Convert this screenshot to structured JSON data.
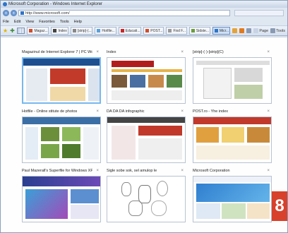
{
  "window": {
    "title": "Microsoft Corporation - Windows Internet Explorer"
  },
  "address_bar": {
    "url": "http://www.microsoft.com/"
  },
  "menu": {
    "items": [
      "File",
      "Edit",
      "View",
      "Favorites",
      "Tools",
      "Help"
    ]
  },
  "tabs": [
    {
      "label": "Magaz..."
    },
    {
      "label": "Index"
    },
    {
      "label": "[strip]-(..."
    },
    {
      "label": "Hotfile..."
    },
    {
      "label": "Educati..."
    },
    {
      "label": "POST..."
    },
    {
      "label": "Fixd F..."
    },
    {
      "label": "Sidste..."
    },
    {
      "label": "Micr..."
    }
  ],
  "toolbar": {
    "page_label": "Page",
    "tools_label": "Tools"
  },
  "quick_tabs": [
    {
      "title": "Magazinul de Internet Explorer 7 | PC World"
    },
    {
      "title": "Index"
    },
    {
      "title": "[strip]-(·)-[strip](C)"
    },
    {
      "title": "Hotfile - Online stitute de photos"
    },
    {
      "title": "DA DA DA infographic"
    },
    {
      "title": "POST.ro - Yhe index"
    },
    {
      "title": "Paul Mazerall's Superfile for Windows XP 6..."
    },
    {
      "title": "Sigle sobe sok, sel amulop le"
    },
    {
      "title": "Microsoft Corporation"
    }
  ],
  "badge": {
    "number": "8"
  },
  "colors": {
    "accent": "#2e74c9",
    "selected_border": "#77b8ee",
    "badge": "#d8412b"
  }
}
